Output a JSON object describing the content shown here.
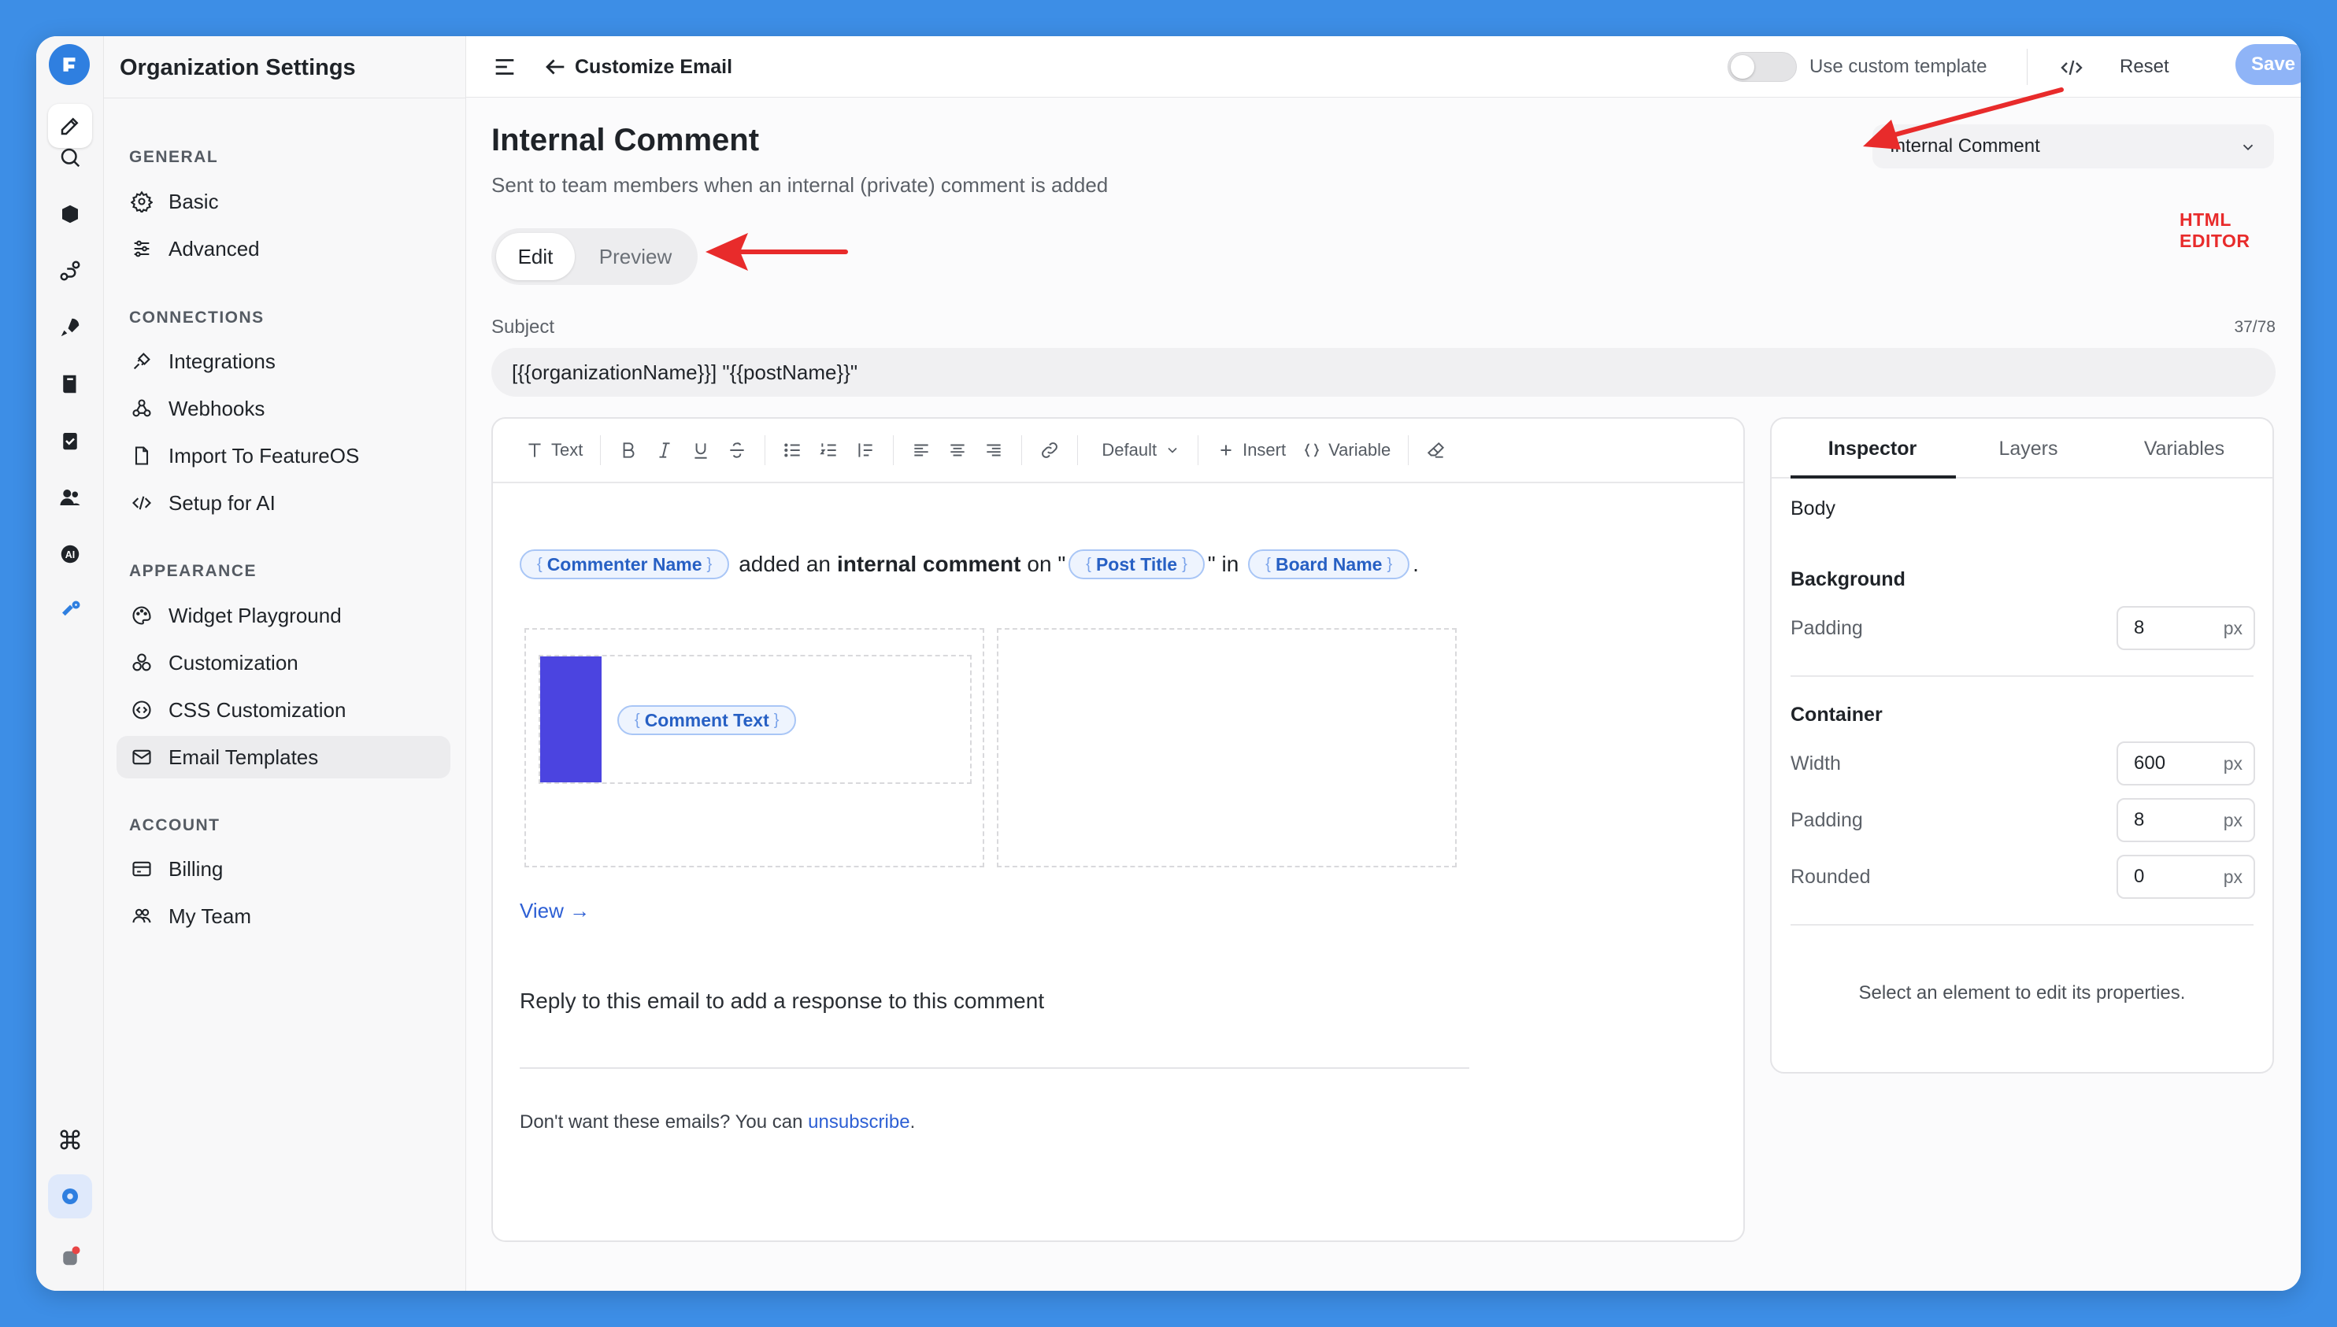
{
  "sidebar": {
    "title": "Organization Settings",
    "sections": [
      {
        "label": "GENERAL",
        "items": [
          {
            "label": "Basic",
            "icon": "gear-icon"
          },
          {
            "label": "Advanced",
            "icon": "sliders-icon"
          }
        ]
      },
      {
        "label": "CONNECTIONS",
        "items": [
          {
            "label": "Integrations",
            "icon": "plug-icon"
          },
          {
            "label": "Webhooks",
            "icon": "webhook-icon"
          },
          {
            "label": "Import To FeatureOS",
            "icon": "file-import-icon"
          },
          {
            "label": "Setup for AI",
            "icon": "code-icon"
          }
        ]
      },
      {
        "label": "APPEARANCE",
        "items": [
          {
            "label": "Widget Playground",
            "icon": "palette-icon"
          },
          {
            "label": "Customization",
            "icon": "shapes-icon"
          },
          {
            "label": "CSS Customization",
            "icon": "css-icon"
          },
          {
            "label": "Email Templates",
            "icon": "mail-icon",
            "active": true
          }
        ]
      },
      {
        "label": "ACCOUNT",
        "items": [
          {
            "label": "Billing",
            "icon": "credit-card-icon"
          },
          {
            "label": "My Team",
            "icon": "team-icon"
          }
        ]
      }
    ]
  },
  "topbar": {
    "title": "Customize Email",
    "toggle_label": "Use custom template",
    "toggle_on": false,
    "reset_label": "Reset",
    "save_label": "Save"
  },
  "page": {
    "title": "Internal Comment",
    "subtitle": "Sent to team members when an internal (private) comment is added",
    "template_select": "Internal Comment",
    "tabs": {
      "edit": "Edit",
      "preview": "Preview"
    },
    "subject_label": "Subject",
    "subject_count": "37/78",
    "subject_value": "[{{organizationName}}] \"{{postName}}\""
  },
  "toolbar": {
    "text_label": "Text",
    "font_select": "Default",
    "insert_label": "Insert",
    "variable_label": "Variable"
  },
  "email": {
    "chip_commenter": "Commenter Name",
    "text_added": "added an",
    "text_bold": "internal comment",
    "text_on": "on \"",
    "chip_post": "Post Title",
    "text_in": "\" in",
    "chip_board": "Board Name",
    "text_period": ".",
    "chip_comment": "Comment Text",
    "view_link": "View →",
    "reply_text": "Reply to this email to add a response to this comment",
    "unsub_prefix": "Don't want these emails? You can",
    "unsub_link": "unsubscribe",
    "unsub_suffix": ".",
    "accent_color": "#4b44e0"
  },
  "inspector": {
    "tabs": [
      "Inspector",
      "Layers",
      "Variables"
    ],
    "body_label": "Body",
    "background_label": "Background",
    "bg_padding_label": "Padding",
    "bg_padding_value": "8",
    "container_label": "Container",
    "width_label": "Width",
    "width_value": "600",
    "padding_label": "Padding",
    "padding_value": "8",
    "rounded_label": "Rounded",
    "rounded_value": "0",
    "unit": "px",
    "hint": "Select an element to edit its properties."
  },
  "annotation": {
    "html_editor": "HTML EDITOR",
    "color": "#e82b2b"
  }
}
